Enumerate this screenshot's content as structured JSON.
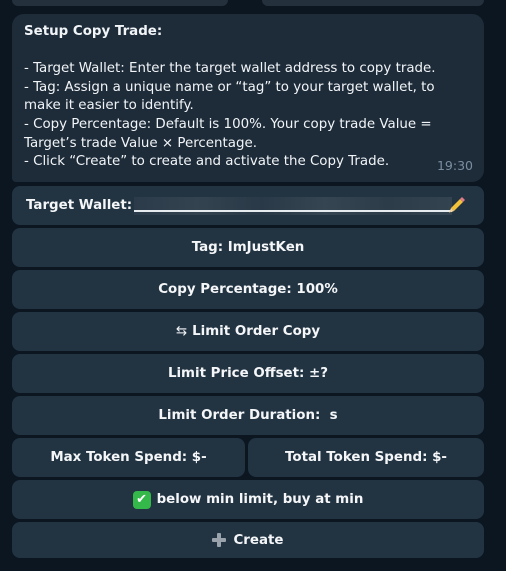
{
  "message": {
    "title": "Setup Copy Trade:",
    "lines": [
      "- Target Wallet: Enter the target wallet address to copy trade.",
      "- Tag: Assign a unique name or “tag” to your target wallet, to make it easier to identify.",
      "- Copy Percentage: Default is 100%. Your copy trade Value = Target’s trade Value × Percentage.",
      "- Click “Create” to create and activate the Copy Trade."
    ],
    "time": "19:30"
  },
  "keyboard": {
    "target_wallet_label": "Target Wallet:",
    "target_wallet_edit_icon": "pencil-icon",
    "tag": "Tag: ImJustKen",
    "copy_percentage": "Copy Percentage: 100%",
    "limit_order_icon": "⇆",
    "limit_order_copy": "Limit Order Copy",
    "limit_price_offset": "Limit Price Offset: ±?",
    "limit_order_duration": "Limit Order Duration:  s",
    "max_token_spend": "Max Token Spend: $-",
    "total_token_spend": "Total Token Spend: $-",
    "below_min_icon": "check-icon",
    "below_min_check": "✔",
    "below_min": "below min limit, buy at min",
    "create_icon": "plus-icon",
    "create": "Create"
  },
  "colors": {
    "background": "#0c1620",
    "bubble": "#1e2c3a",
    "button": "#223342",
    "timestamp": "#7b8ea0",
    "check_green": "#34b84a"
  }
}
